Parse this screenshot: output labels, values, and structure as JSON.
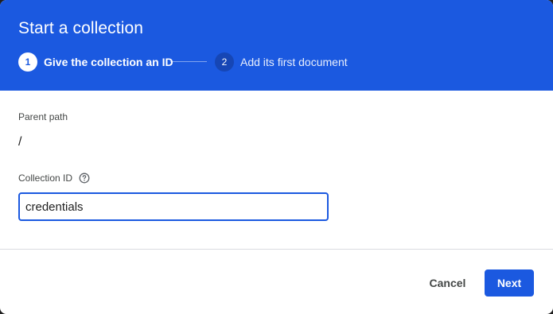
{
  "dialog": {
    "title": "Start a collection",
    "steps": [
      {
        "number": "1",
        "label": "Give the collection an ID",
        "state": "active"
      },
      {
        "number": "2",
        "label": "Add its first document",
        "state": "upcoming"
      }
    ]
  },
  "form": {
    "parent_path_label": "Parent path",
    "parent_path_value": "/",
    "collection_id_label": "Collection ID",
    "collection_id_help_icon": "help-circle-icon",
    "collection_id_value": "credentials"
  },
  "actions": {
    "cancel_label": "Cancel",
    "next_label": "Next"
  },
  "colors": {
    "header_bg": "#1b59e0",
    "accent": "#1b59e0",
    "inactive_step_circle": "#1646b5"
  }
}
